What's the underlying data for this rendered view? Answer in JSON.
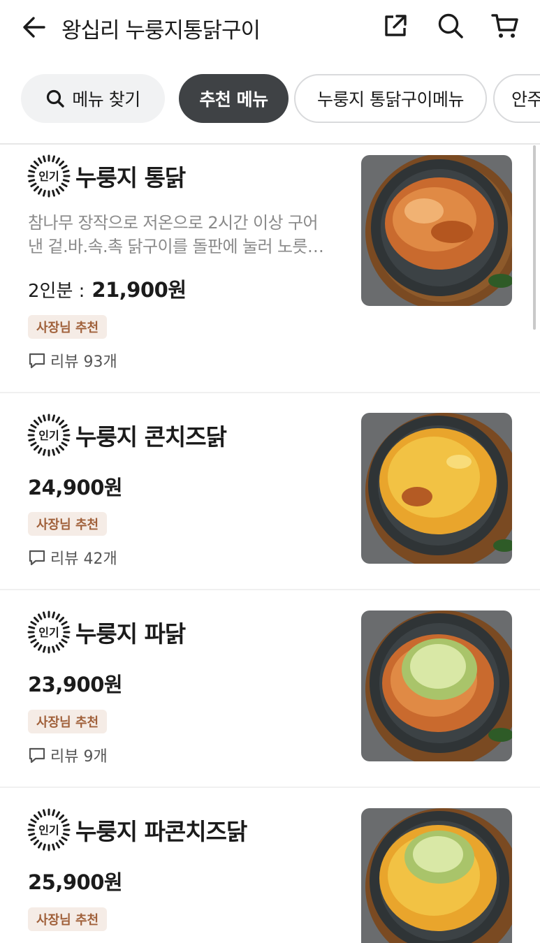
{
  "header": {
    "title": "왕십리 누룽지통닭구이",
    "back_icon": "arrow-left-icon",
    "share_icon": "share-icon",
    "search_icon": "search-icon",
    "cart_icon": "cart-icon"
  },
  "chips": {
    "search_label": "메뉴 찾기",
    "items": [
      "추천 메뉴",
      "누룽지 통닭구이메뉴",
      "안주"
    ],
    "active_index": 0
  },
  "badge_text": "인기",
  "owner_tag": "사장님 추천",
  "menu": [
    {
      "name": "누룽지 통닭",
      "desc_line1": "참나무 장작으로 저온으로 2시간 이상 구어",
      "desc_line2": "낸 겉.바.속.촉 닭구이를 돌판에 눌러 노릇…",
      "price_prefix": "2인분 :",
      "price": "21,900원",
      "review": "리뷰 93개"
    },
    {
      "name": "누룽지 콘치즈닭",
      "price": "24,900원",
      "review": "리뷰 42개"
    },
    {
      "name": "누룽지 파닭",
      "price": "23,900원",
      "review": "리뷰 9개"
    },
    {
      "name": "누룽지 파콘치즈닭",
      "price": "25,900원"
    }
  ],
  "colors": {
    "active_chip": "#3f4245",
    "tag_bg": "#f5ece6",
    "tag_text": "#a0603a"
  }
}
